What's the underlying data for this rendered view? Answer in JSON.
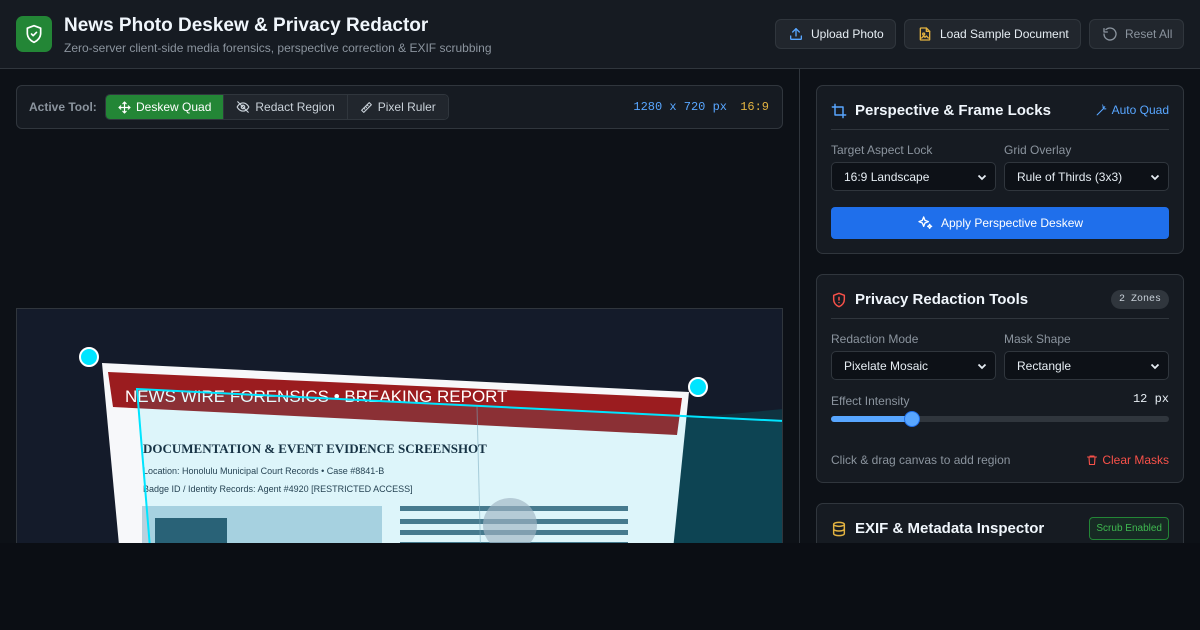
{
  "app": {
    "title": "News Photo Deskew & Privacy Redactor",
    "subtitle": "Zero-server client-side media forensics, perspective correction & EXIF scrubbing",
    "logo_icon": "shield-check-icon"
  },
  "header_actions": {
    "upload": "Upload Photo",
    "sample": "Load Sample Document",
    "reset": "Reset All"
  },
  "toolbar": {
    "label": "Active Tool:",
    "tools": [
      {
        "label": "Deskew Quad",
        "icon": "move-icon",
        "active": true
      },
      {
        "label": "Redact Region",
        "icon": "eye-off-icon",
        "active": false
      },
      {
        "label": "Pixel Ruler",
        "icon": "ruler-icon",
        "active": false
      }
    ],
    "dimensions": "1280 x 720 px",
    "ratio": "16:9"
  },
  "canvas": {
    "banner": "NEWS WIRE FORENSICS • BREAKING REPORT",
    "heading": "DOCUMENTATION & EVENT EVIDENCE SCREENSHOT",
    "line1": "Location: Honolulu Municipal Court Records • Case #8841-B",
    "line2": "Badge ID / Identity Records: Agent #4920 [RESTRICTED ACCESS]"
  },
  "perspective": {
    "title": "Perspective & Frame Locks",
    "auto_quad": "Auto Quad",
    "aspect_label": "Target Aspect Lock",
    "aspect_value": "16:9 Landscape",
    "grid_label": "Grid Overlay",
    "grid_value": "Rule of Thirds (3x3)",
    "apply": "Apply Perspective Deskew"
  },
  "redaction": {
    "title": "Privacy Redaction Tools",
    "zones_badge": "2 Zones",
    "mode_label": "Redaction Mode",
    "mode_value": "Pixelate Mosaic",
    "shape_label": "Mask Shape",
    "shape_value": "Rectangle",
    "intensity_label": "Effect Intensity",
    "intensity_display": "12 px",
    "intensity_fraction": 0.24,
    "hint": "Click & drag canvas to add region",
    "clear": "Clear Masks"
  },
  "exif": {
    "title": "EXIF & Metadata Inspector",
    "badge": "Scrub Enabled"
  },
  "colors": {
    "accent_green": "#238636",
    "accent_blue": "#1f6feb",
    "link_blue": "#58a6ff",
    "danger": "#f85149",
    "warning": "#e3b341",
    "handle_cyan": "#00e5ff"
  }
}
